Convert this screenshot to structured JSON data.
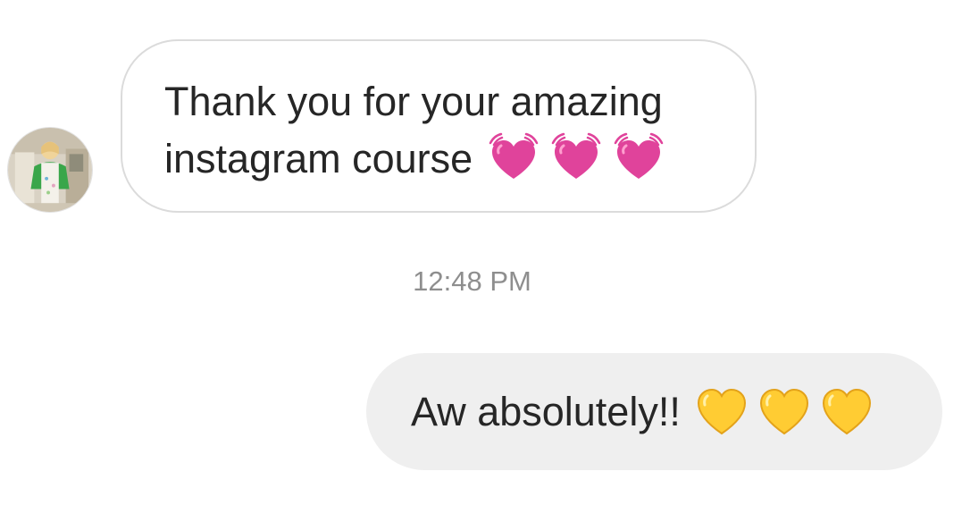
{
  "conversation": {
    "incoming": {
      "line1": "Thank you for your amazing",
      "line2": "instagram course",
      "emoji_icons": [
        "beating-heart-icon",
        "beating-heart-icon",
        "beating-heart-icon"
      ]
    },
    "timestamp": "12:48 PM",
    "outgoing": {
      "text": "Aw absolutely!!",
      "emoji_icons": [
        "yellow-heart-icon",
        "yellow-heart-icon",
        "yellow-heart-icon"
      ]
    }
  },
  "colors": {
    "incoming_border": "#dbdbdb",
    "outgoing_bg": "#efefef",
    "text": "#262626",
    "timestamp": "#8e8e8e",
    "pink_heart": "#e0439b",
    "yellow_heart": "#ffcc33"
  }
}
